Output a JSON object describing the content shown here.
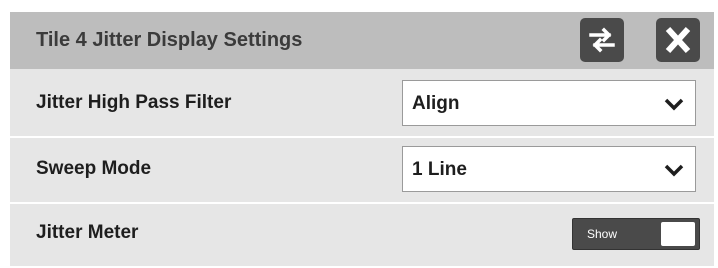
{
  "dialog": {
    "title": "Tile 4 Jitter Display Settings",
    "swap_icon": "swap-arrows-icon",
    "close_icon": "close-x-icon"
  },
  "settings": [
    {
      "label": "Jitter High Pass Filter",
      "control": "dropdown",
      "value": "Align"
    },
    {
      "label": "Sweep Mode",
      "control": "dropdown",
      "value": "1 Line"
    },
    {
      "label": "Jitter Meter",
      "control": "toggle",
      "value": "Show"
    }
  ],
  "icons": {
    "dropdown": "chevron-down-icon"
  },
  "colors": {
    "title_bar": "#bdbdbd",
    "panel": "#e6e6e6",
    "button_dark": "#4a4a4a"
  }
}
